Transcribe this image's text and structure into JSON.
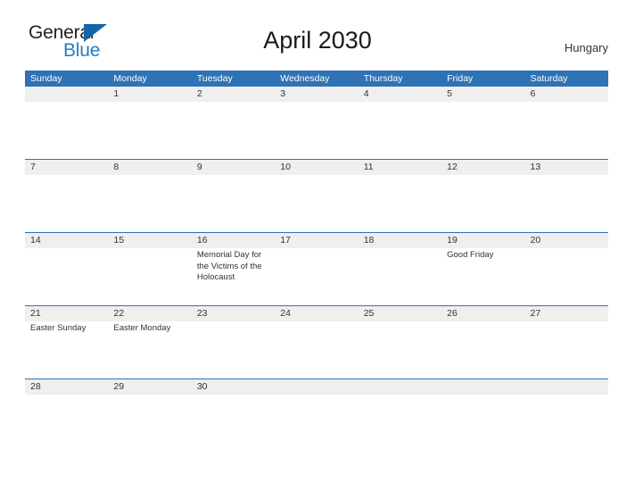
{
  "logo": {
    "word_one": "General",
    "word_two": "Blue",
    "triangle_color": "#1565a8",
    "blue_text_color": "#1f7fc4"
  },
  "header": {
    "title": "April 2030",
    "country": "Hungary"
  },
  "theme": {
    "header_blue": "#2f72b5",
    "row_band_gray": "#efefef",
    "text_color": "#333333"
  },
  "calendar": {
    "weekdays": [
      "Sunday",
      "Monday",
      "Tuesday",
      "Wednesday",
      "Thursday",
      "Friday",
      "Saturday"
    ],
    "weeks": [
      [
        {
          "date": "",
          "events": []
        },
        {
          "date": "1",
          "events": []
        },
        {
          "date": "2",
          "events": []
        },
        {
          "date": "3",
          "events": []
        },
        {
          "date": "4",
          "events": []
        },
        {
          "date": "5",
          "events": []
        },
        {
          "date": "6",
          "events": []
        }
      ],
      [
        {
          "date": "7",
          "events": []
        },
        {
          "date": "8",
          "events": []
        },
        {
          "date": "9",
          "events": []
        },
        {
          "date": "10",
          "events": []
        },
        {
          "date": "11",
          "events": []
        },
        {
          "date": "12",
          "events": []
        },
        {
          "date": "13",
          "events": []
        }
      ],
      [
        {
          "date": "14",
          "events": []
        },
        {
          "date": "15",
          "events": []
        },
        {
          "date": "16",
          "events": [
            "Memorial Day for the Victims of the Holocaust"
          ]
        },
        {
          "date": "17",
          "events": []
        },
        {
          "date": "18",
          "events": []
        },
        {
          "date": "19",
          "events": [
            "Good Friday"
          ]
        },
        {
          "date": "20",
          "events": []
        }
      ],
      [
        {
          "date": "21",
          "events": [
            "Easter Sunday"
          ]
        },
        {
          "date": "22",
          "events": [
            "Easter Monday"
          ]
        },
        {
          "date": "23",
          "events": []
        },
        {
          "date": "24",
          "events": []
        },
        {
          "date": "25",
          "events": []
        },
        {
          "date": "26",
          "events": []
        },
        {
          "date": "27",
          "events": []
        }
      ],
      [
        {
          "date": "28",
          "events": []
        },
        {
          "date": "29",
          "events": []
        },
        {
          "date": "30",
          "events": []
        },
        {
          "date": "",
          "events": []
        },
        {
          "date": "",
          "events": []
        },
        {
          "date": "",
          "events": []
        },
        {
          "date": "",
          "events": []
        }
      ]
    ]
  }
}
